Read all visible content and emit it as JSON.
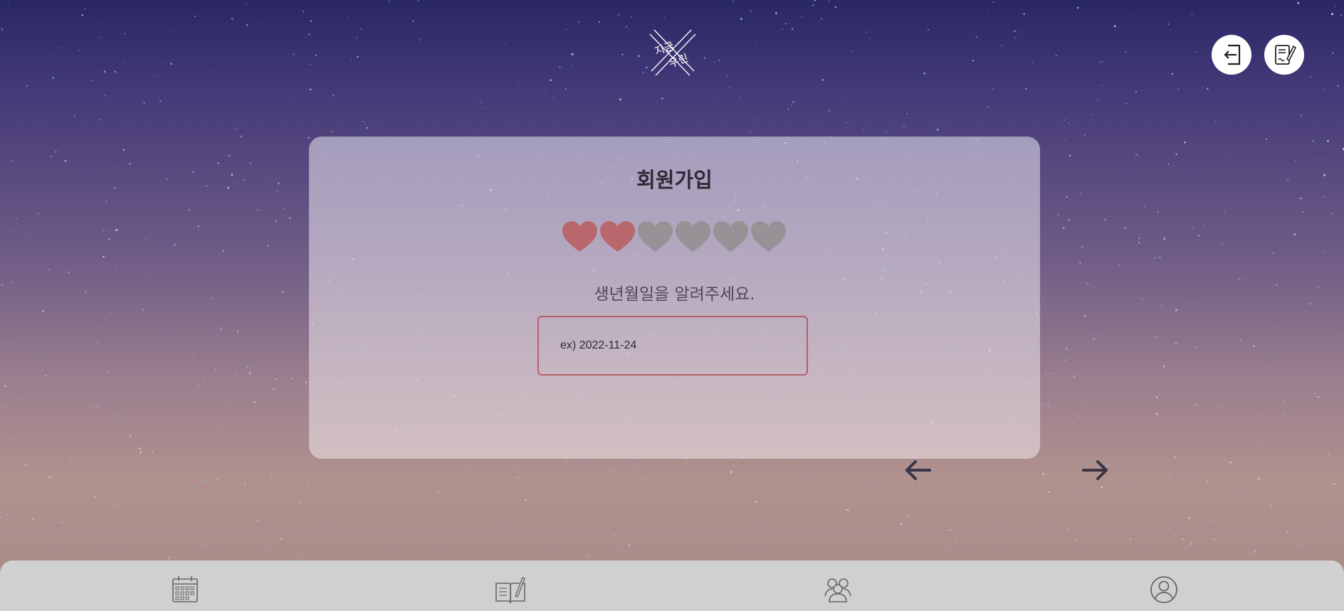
{
  "logo": {
    "text": "지금우린",
    "color": "#ffffff"
  },
  "header": {
    "login_icon": "door-arrow-in-icon",
    "signup_icon": "pencil-note-icon"
  },
  "signup": {
    "title": "회원가입",
    "progress": {
      "filled": 2,
      "total": 6,
      "filled_color": "#b8686c",
      "empty_color": "#969296"
    },
    "prompt": "생년월일을 알려주세요.",
    "birthdate_input": {
      "value": "",
      "placeholder": "ex) 2022-11-24"
    }
  },
  "navigation": {
    "back_icon": "arrow-left-icon",
    "next_icon": "arrow-right-icon"
  },
  "bottom_nav": {
    "items": [
      {
        "icon": "calendar-icon"
      },
      {
        "icon": "diary-icon"
      },
      {
        "icon": "people-icon"
      },
      {
        "icon": "profile-icon"
      }
    ]
  },
  "colors": {
    "accent": "#b4606a",
    "sky_top": "#2a2766",
    "sky_bottom": "#b0918e",
    "nav_bg": "#d0d0d0"
  }
}
